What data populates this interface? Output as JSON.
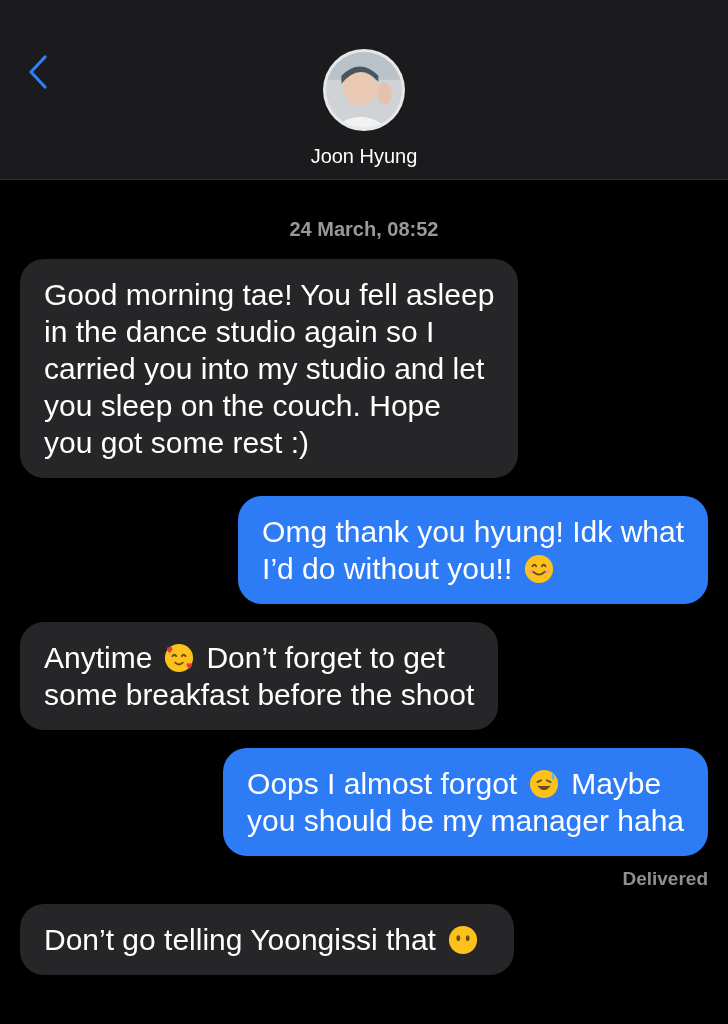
{
  "contact": {
    "name": "Joon Hyung"
  },
  "timestamp": "24 March, 08:52",
  "messages": [
    {
      "outgoing": false,
      "lines": [
        [
          {
            "kind": "text",
            "text": "Good morning tae! You fell asleep"
          }
        ],
        [
          {
            "kind": "text",
            "text": "in the dance studio again so I"
          }
        ],
        [
          {
            "kind": "text",
            "text": "carried you into my studio and let"
          }
        ],
        [
          {
            "kind": "text",
            "text": "you sleep on the couch. Hope"
          }
        ],
        [
          {
            "kind": "text",
            "text": "you got some rest :)"
          }
        ]
      ]
    },
    {
      "outgoing": true,
      "lines": [
        [
          {
            "kind": "text",
            "text": "Omg thank you hyung! Idk what"
          }
        ],
        [
          {
            "kind": "text",
            "text": "I’d do without you!!"
          },
          {
            "kind": "smile"
          }
        ]
      ]
    },
    {
      "outgoing": false,
      "lines": [
        [
          {
            "kind": "text",
            "text": "Anytime"
          },
          {
            "kind": "hearts"
          },
          {
            "kind": "text",
            "text": "Don’t forget to get"
          }
        ],
        [
          {
            "kind": "text",
            "text": "some breakfast before the shoot"
          }
        ]
      ]
    },
    {
      "outgoing": true,
      "lines": [
        [
          {
            "kind": "text",
            "text": "Oops I almost forgot"
          },
          {
            "kind": "sweat"
          },
          {
            "kind": "text",
            "text": "Maybe"
          }
        ],
        [
          {
            "kind": "text",
            "text": "you should be my manager haha"
          }
        ]
      ],
      "status": "Delivered"
    },
    {
      "outgoing": false,
      "lines": [
        [
          {
            "kind": "text",
            "text": "Don’t go telling Yoongissi that"
          },
          {
            "kind": "no-mouth"
          }
        ]
      ]
    }
  ]
}
